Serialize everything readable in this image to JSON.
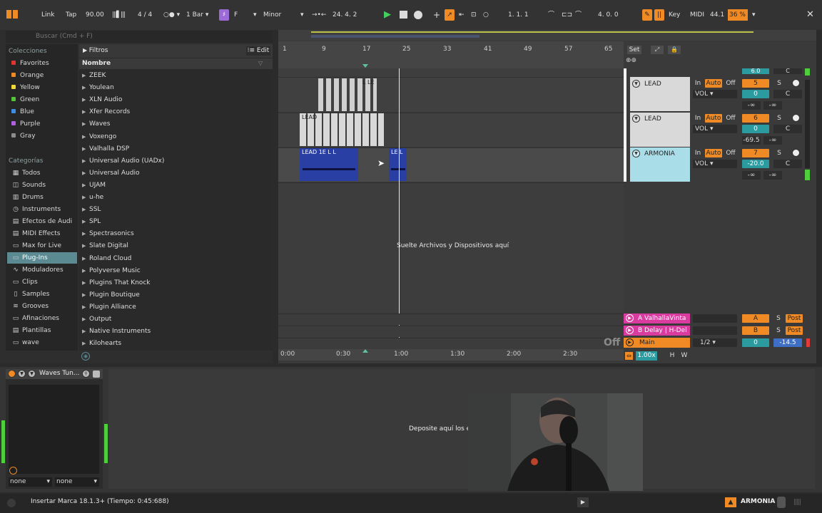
{
  "transport": {
    "link": "Link",
    "tap": "Tap",
    "tempo": "90.00",
    "signature": "4 / 4",
    "quantize": "1 Bar",
    "key": "F",
    "scale": "Minor",
    "arrangement_position": "24. 4. 2",
    "loop_start": "1. 1. 1",
    "loop_length": "4. 0. 0",
    "key_map": "Key",
    "midi_map": "MIDI",
    "sample_rate": "44.1",
    "cpu": "36 %"
  },
  "browser": {
    "search_placeholder": "Buscar (Cmd + F)",
    "collections_header": "Colecciones",
    "collections": [
      {
        "label": "Favorites",
        "color": "#e0352f"
      },
      {
        "label": "Orange",
        "color": "#f08a24"
      },
      {
        "label": "Yellow",
        "color": "#f2d936"
      },
      {
        "label": "Green",
        "color": "#52c436"
      },
      {
        "label": "Blue",
        "color": "#3d8ee8"
      },
      {
        "label": "Purple",
        "color": "#b05fe0"
      },
      {
        "label": "Gray",
        "color": "#8c8c8c"
      }
    ],
    "categories_header": "Categorías",
    "categories": [
      {
        "label": "Todos",
        "icon": "grid-icon"
      },
      {
        "label": "Sounds",
        "icon": "sounds-icon"
      },
      {
        "label": "Drums",
        "icon": "drums-icon"
      },
      {
        "label": "Instruments",
        "icon": "instrument-icon"
      },
      {
        "label": "Efectos de Audi",
        "icon": "audio-effect-icon"
      },
      {
        "label": "MIDI Effects",
        "icon": "midi-effect-icon"
      },
      {
        "label": "Max for Live",
        "icon": "max-icon"
      },
      {
        "label": "Plug-Ins",
        "icon": "plugin-icon"
      },
      {
        "label": "Moduladores",
        "icon": "modulator-icon"
      },
      {
        "label": "Clips",
        "icon": "clips-icon"
      },
      {
        "label": "Samples",
        "icon": "samples-icon"
      },
      {
        "label": "Grooves",
        "icon": "grooves-icon"
      },
      {
        "label": "Afinaciones",
        "icon": "tuning-icon"
      },
      {
        "label": "Plantillas",
        "icon": "templates-icon"
      },
      {
        "label": "wave",
        "icon": "folder-icon"
      }
    ],
    "filters_label": "Filtros",
    "edit_label": "Edit",
    "column_name": "Nombre",
    "items": [
      "ZEEK",
      "Youlean",
      "XLN Audio",
      "Xfer Records",
      "Waves",
      "Voxengo",
      "Valhalla DSP",
      "Universal Audio (UADx)",
      "Universal Audio",
      "UJAM",
      "u-he",
      "SSL",
      "SPL",
      "Spectrasonics",
      "Slate Digital",
      "Roland Cloud",
      "Polyverse Music",
      "Plugins That Knock",
      "Plugin Boutique",
      "Plugin Alliance",
      "Output",
      "Native Instruments",
      "Kilohearts"
    ]
  },
  "arrangement": {
    "set_label": "Set",
    "bar_markers": [
      "1",
      "9",
      "17",
      "25",
      "33",
      "41",
      "49",
      "57",
      "65"
    ],
    "time_markers": [
      "0:00",
      "0:30",
      "1:00",
      "1:30",
      "2:00",
      "2:30"
    ],
    "drop_hint": "Suelte Archivos y Dispositivos aquí",
    "clip_labels": {
      "lead2": "LEAD",
      "armonia_a": "LEAD 1E L L",
      "armonia_b": "LE L",
      "lead1_tail": "L LE"
    },
    "top_volume": "6.0",
    "top_pan": "C",
    "tracks": [
      {
        "name": "LEAD",
        "number": "5",
        "volume": "0",
        "pan": "C",
        "send_a": "-∞",
        "send_b": "-∞",
        "peak": "",
        "color": "#d9d9d9"
      },
      {
        "name": "LEAD",
        "number": "6",
        "volume": "0",
        "pan": "C",
        "send_a": "-69.5",
        "send_b": "-∞",
        "peak": "",
        "color": "#d9d9d9"
      },
      {
        "name": "ARMONIA",
        "number": "7",
        "volume": "-20.0",
        "pan": "C",
        "send_a": "-∞",
        "send_b": "-∞",
        "peak": "",
        "color": "#a9dde8"
      }
    ],
    "in_label": "In",
    "auto_label": "Auto",
    "off_label": "Off",
    "vol_label": "VOL",
    "solo_label": "S",
    "returns": [
      {
        "name": "A ValhallaVinta",
        "letter": "A",
        "post": "Post"
      },
      {
        "name": "B Delay | H-Del",
        "letter": "B",
        "post": "Post"
      }
    ],
    "main": {
      "name": "Main",
      "cue": "1/2",
      "volume": "0",
      "peak": "-14.5"
    },
    "main_off": "Off",
    "zoom": "1.00x",
    "h_label": "H",
    "w_label": "W"
  },
  "device": {
    "title": "Waves Tun...",
    "drop_hint": "Deposite aquí los e",
    "chooser_a": "none",
    "chooser_b": "none"
  },
  "status": {
    "message": "Insertar Marca 18.1.3+ (Tiempo: 0:45:688)",
    "selected_track": "ARMONIA"
  }
}
